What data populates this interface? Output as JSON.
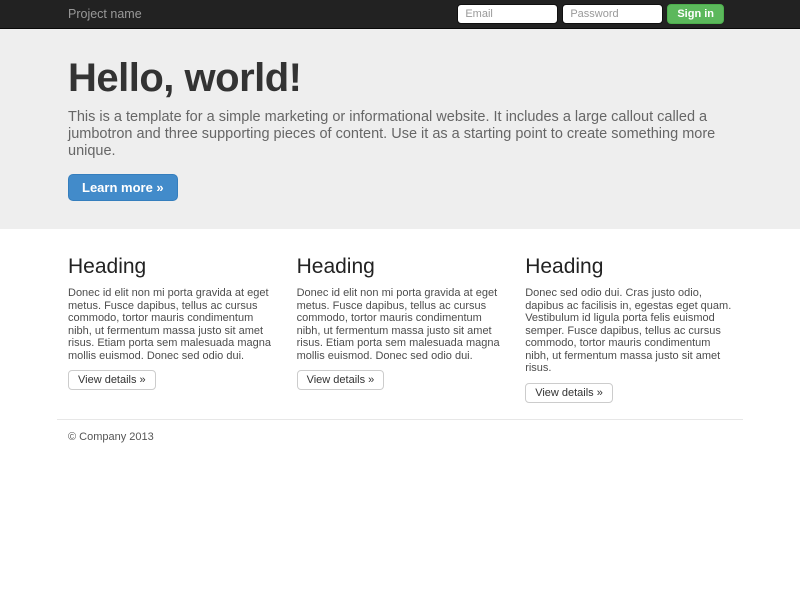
{
  "navbar": {
    "brand": "Project name",
    "form": {
      "email_placeholder": "Email",
      "password_placeholder": "Password",
      "signin_label": "Sign in"
    }
  },
  "jumbotron": {
    "title": "Hello, world!",
    "lead": "This is a template for a simple marketing or informational website. It includes a large callout called a jumbotron and three supporting pieces of content. Use it as a starting point to create something more unique.",
    "cta_label": "Learn more »"
  },
  "columns": [
    {
      "heading": "Heading",
      "body": "Donec id elit non mi porta gravida at eget metus. Fusce dapibus, tellus ac cursus commodo, tortor mauris condimentum nibh, ut fermentum massa justo sit amet risus. Etiam porta sem malesuada magna mollis euismod. Donec sed odio dui.",
      "button_label": "View details »"
    },
    {
      "heading": "Heading",
      "body": "Donec id elit non mi porta gravida at eget metus. Fusce dapibus, tellus ac cursus commodo, tortor mauris condimentum nibh, ut fermentum massa justo sit amet risus. Etiam porta sem malesuada magna mollis euismod. Donec sed odio dui.",
      "button_label": "View details »"
    },
    {
      "heading": "Heading",
      "body": "Donec sed odio dui. Cras justo odio, dapibus ac facilisis in, egestas eget quam. Vestibulum id ligula porta felis euismod semper. Fusce dapibus, tellus ac cursus commodo, tortor mauris condimentum nibh, ut fermentum massa justo sit amet risus.",
      "button_label": "View details »"
    }
  ],
  "footer": {
    "copyright": "© Company 2013"
  },
  "colors": {
    "navbar_bg": "#222222",
    "jumbotron_bg": "#eeeeee",
    "primary": "#428bca",
    "success": "#5cb85c"
  }
}
